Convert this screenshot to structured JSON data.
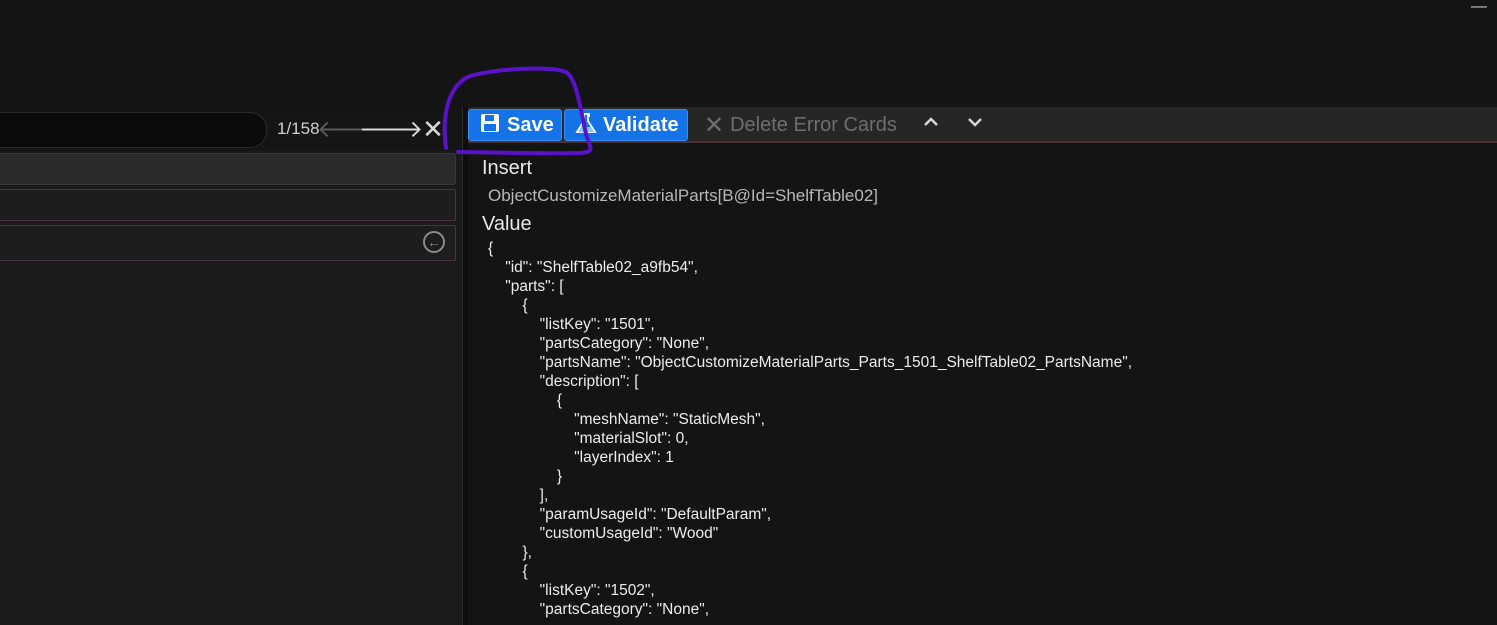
{
  "window": {
    "minimize_glyph": "—"
  },
  "search": {
    "counter": "1/158",
    "value": ""
  },
  "toolbar": {
    "save_label": "Save",
    "validate_label": "Validate",
    "delete_label": "Delete Error Cards"
  },
  "icons": {
    "save": "floppy-disk-icon",
    "validate": "flask-icon",
    "prev": "arrow-left-icon",
    "next": "arrow-right-icon",
    "close": "close-icon",
    "delete": "close-icon",
    "up": "chevron-up-icon",
    "down": "chevron-down-icon",
    "back": "circle-back-arrow-icon"
  },
  "colors": {
    "accent": "#1473e6",
    "annotation": "#5a12c8"
  },
  "editor": {
    "insert_label": "Insert",
    "path": "ObjectCustomizeMaterialParts[B@Id=ShelfTable02]",
    "value_label": "Value",
    "json_text": "{\n    \"id\": \"ShelfTable02_a9fb54\",\n    \"parts\": [\n        {\n            \"listKey\": \"1501\",\n            \"partsCategory\": \"None\",\n            \"partsName\": \"ObjectCustomizeMaterialParts_Parts_1501_ShelfTable02_PartsName\",\n            \"description\": [\n                {\n                    \"meshName\": \"StaticMesh\",\n                    \"materialSlot\": 0,\n                    \"layerIndex\": 1\n                }\n            ],\n            \"paramUsageId\": \"DefaultParam\",\n            \"customUsageId\": \"Wood\"\n        },\n        {\n            \"listKey\": \"1502\",\n            \"partsCategory\": \"None\","
  }
}
